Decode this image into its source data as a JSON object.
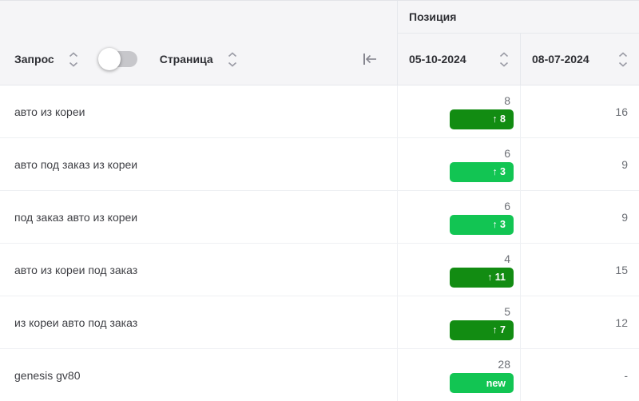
{
  "header": {
    "query_label": "Запрос",
    "page_label": "Страница",
    "group_label": "Позиция",
    "date_columns": [
      "05-10-2024",
      "08-07-2024"
    ]
  },
  "toggle": {
    "state": "off"
  },
  "colors": {
    "badge_green_dark": "#128c12",
    "badge_green_bright": "#12c553",
    "toggle_track": "#c7c7cb",
    "header_bg": "#f5f5f7"
  },
  "rows": [
    {
      "query": "авто из кореи",
      "current": "8",
      "change": "↑ 8",
      "change_style": "strong",
      "previous": "16"
    },
    {
      "query": "авто под заказ из кореи",
      "current": "6",
      "change": "↑ 3",
      "change_style": "light",
      "previous": "9"
    },
    {
      "query": "под заказ авто из кореи",
      "current": "6",
      "change": "↑ 3",
      "change_style": "light",
      "previous": "9"
    },
    {
      "query": "авто из кореи под заказ",
      "current": "4",
      "change": "↑ 11",
      "change_style": "strong",
      "previous": "15"
    },
    {
      "query": "из кореи авто под заказ",
      "current": "5",
      "change": "↑ 7",
      "change_style": "strong",
      "previous": "12"
    },
    {
      "query": "genesis gv80",
      "current": "28",
      "change": "new",
      "change_style": "light",
      "previous": "-"
    }
  ]
}
